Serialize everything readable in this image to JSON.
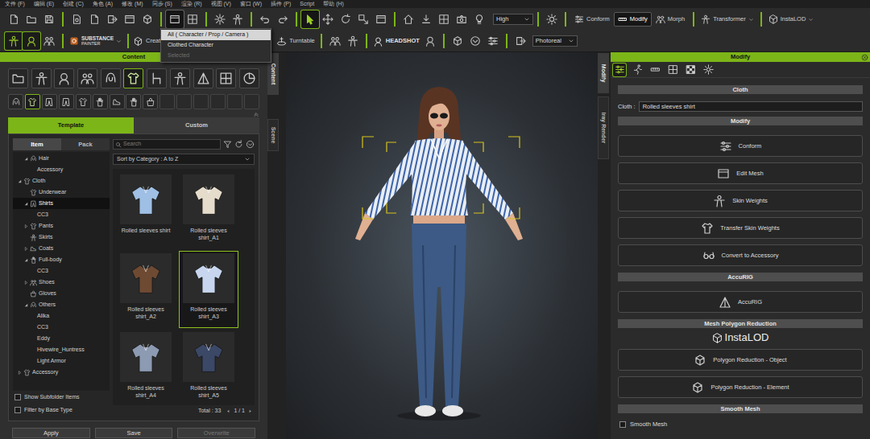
{
  "menu": [
    "文件 (F)",
    "编辑 (E)",
    "创建 (C)",
    "角色 (A)",
    "修改 (M)",
    "同步 (S)",
    "渲染 (R)",
    "视图 (V)",
    "窗口 (W)",
    "插件 (P)",
    "Script",
    "帮助 (H)"
  ],
  "toolbar": {
    "transform_tools": [
      {
        "selected": true
      },
      {
        "selected": false
      },
      {
        "selected": false
      },
      {
        "selected": false
      },
      {
        "selected": false
      }
    ],
    "quality": "High",
    "mode_buttons": [
      {
        "label": "Conform",
        "selected": false
      },
      {
        "label": "Modify",
        "selected": true
      },
      {
        "label": "Morph",
        "selected": false
      }
    ],
    "transformer": "Transformer",
    "instalod": "InstaLOD",
    "toggles": [
      {
        "on": true
      },
      {
        "on": true
      }
    ],
    "substance": [
      "SUBSTANCE",
      "PAINTER"
    ],
    "create": "Creat",
    "turntable": "Turntable",
    "headshot": "HEADSHOT",
    "render_mode": "Photoreal"
  },
  "scope_menu": [
    {
      "label": "All ( Character / Prop / Camera )",
      "selected": true,
      "disabled": false
    },
    {
      "label": "Clothed Character",
      "selected": false,
      "disabled": false
    },
    {
      "label": "Selected",
      "selected": false,
      "disabled": true
    }
  ],
  "content": {
    "title": "Content",
    "categories": [
      {
        "selected": false
      },
      {
        "selected": false
      },
      {
        "selected": false
      },
      {
        "selected": false
      },
      {
        "selected": false
      },
      {
        "selected": true
      },
      {
        "selected": false
      },
      {
        "selected": false
      },
      {
        "selected": false
      },
      {
        "selected": false
      },
      {
        "selected": false
      }
    ],
    "subcategories": [
      {
        "selected": false
      },
      {
        "selected": true
      },
      {
        "selected": false
      },
      {
        "selected": false
      },
      {
        "selected": false
      },
      {
        "selected": false
      },
      {
        "selected": false
      },
      {
        "selected": false
      },
      {
        "selected": false
      }
    ],
    "tabs": [
      {
        "label": "Template",
        "selected": true
      },
      {
        "label": "Custom",
        "selected": false
      }
    ],
    "tree_tabs": [
      {
        "label": "Item",
        "selected": true
      },
      {
        "label": "Pack",
        "selected": false
      }
    ],
    "tree": [
      {
        "label": "Hair",
        "depth": 1,
        "kind": "branch",
        "expanded": true,
        "selected": false
      },
      {
        "label": "Accessory",
        "depth": 2,
        "kind": "leaf",
        "expanded": false,
        "selected": false
      },
      {
        "label": "Cloth",
        "depth": 0,
        "kind": "branch",
        "expanded": true,
        "selected": false
      },
      {
        "label": "Underwear",
        "depth": 1,
        "kind": "leaf",
        "expanded": false,
        "selected": false
      },
      {
        "label": "Shirts",
        "depth": 1,
        "kind": "branch",
        "expanded": true,
        "selected": true
      },
      {
        "label": "CC3",
        "depth": 2,
        "kind": "leaf",
        "expanded": false,
        "selected": false
      },
      {
        "label": "Pants",
        "depth": 1,
        "kind": "branch",
        "expanded": false,
        "selected": false
      },
      {
        "label": "Skirts",
        "depth": 1,
        "kind": "leaf",
        "expanded": false,
        "selected": false
      },
      {
        "label": "Coats",
        "depth": 1,
        "kind": "branch",
        "expanded": false,
        "selected": false
      },
      {
        "label": "Full-body",
        "depth": 1,
        "kind": "branch",
        "expanded": true,
        "selected": false
      },
      {
        "label": "CC3",
        "depth": 2,
        "kind": "leaf",
        "expanded": false,
        "selected": false
      },
      {
        "label": "Shoes",
        "depth": 1,
        "kind": "branch",
        "expanded": false,
        "selected": false
      },
      {
        "label": "Gloves",
        "depth": 1,
        "kind": "leaf",
        "expanded": false,
        "selected": false
      },
      {
        "label": "Others",
        "depth": 1,
        "kind": "branch",
        "expanded": true,
        "selected": false
      },
      {
        "label": "Alika",
        "depth": 2,
        "kind": "leaf",
        "expanded": false,
        "selected": false
      },
      {
        "label": "CC3",
        "depth": 2,
        "kind": "leaf",
        "expanded": false,
        "selected": false
      },
      {
        "label": "Eddy",
        "depth": 2,
        "kind": "leaf",
        "expanded": false,
        "selected": false
      },
      {
        "label": "Hivewire_Huntress",
        "depth": 2,
        "kind": "leaf",
        "expanded": false,
        "selected": false
      },
      {
        "label": "Light Armor",
        "depth": 2,
        "kind": "leaf",
        "expanded": false,
        "selected": false
      },
      {
        "label": "Accessory",
        "depth": 0,
        "kind": "branch",
        "expanded": false,
        "selected": false
      }
    ],
    "search": {
      "placeholder": "Search"
    },
    "sort": "Sort by Category : A to Z",
    "items": [
      {
        "label": "Rolled sleeves shirt",
        "color": "#9fbfe4",
        "selected": false
      },
      {
        "label": "Rolled sleeves shirt_A1",
        "color": "#e6dccb",
        "selected": false
      },
      {
        "label": "Rolled sleeves shirt_A2",
        "color": "#6e4a33",
        "selected": false
      },
      {
        "label": "Rolled sleeves shirt_A3",
        "color": "#c7d6ee",
        "selected": true
      },
      {
        "label": "Rolled sleeves shirt_A4",
        "color": "#8c9ab2",
        "selected": false
      },
      {
        "label": "Rolled sleeves shirt_A5",
        "color": "#3b4866",
        "selected": false
      }
    ],
    "total": "Total : 33",
    "page": "1 / 1",
    "options": [
      {
        "label": "Show Subfolder Items",
        "checked": false
      },
      {
        "label": "Filter by Base Type",
        "checked": false
      }
    ],
    "buttons": [
      {
        "label": "Apply",
        "disabled": false
      },
      {
        "label": "Save",
        "disabled": false
      },
      {
        "label": "Overwrite",
        "disabled": true
      }
    ]
  },
  "side_tabs_left": [
    {
      "label": "Content",
      "selected": true
    },
    {
      "label": "Scene",
      "selected": false
    }
  ],
  "side_tabs_right": [
    {
      "label": "Modify",
      "selected": true
    },
    {
      "label": "Iray Render",
      "selected": false
    }
  ],
  "modify": {
    "title": "Modify",
    "tabs": [
      {
        "selected": true
      },
      {
        "selected": false
      },
      {
        "selected": false
      },
      {
        "selected": false
      },
      {
        "selected": false
      },
      {
        "selected": false
      }
    ],
    "rows": [
      {
        "kind": "header",
        "label": "Cloth"
      },
      {
        "kind": "field",
        "label": "Cloth :",
        "value": "Rolled sleeves shirt"
      },
      {
        "kind": "header",
        "label": "Modify"
      },
      {
        "kind": "button",
        "label": "Conform"
      },
      {
        "kind": "button",
        "label": "Edit Mesh"
      },
      {
        "kind": "button",
        "label": "Skin Weights"
      },
      {
        "kind": "button",
        "label": "Transfer Skin Weights"
      },
      {
        "kind": "button",
        "label": "Convert to Accessory"
      },
      {
        "kind": "header",
        "label": "AccuRIG"
      },
      {
        "kind": "button",
        "label": "AccuRIG"
      },
      {
        "kind": "header",
        "label": "Mesh Polygon Reduction"
      },
      {
        "kind": "logo",
        "label": "InstaLOD"
      },
      {
        "kind": "button",
        "label": "Polygon Reduction - Object"
      },
      {
        "kind": "button",
        "label": "Polygon Reduction - Element"
      },
      {
        "kind": "header",
        "label": "Smooth Mesh"
      },
      {
        "kind": "checkbox",
        "label": "Smooth Mesh",
        "checked": false
      }
    ]
  }
}
